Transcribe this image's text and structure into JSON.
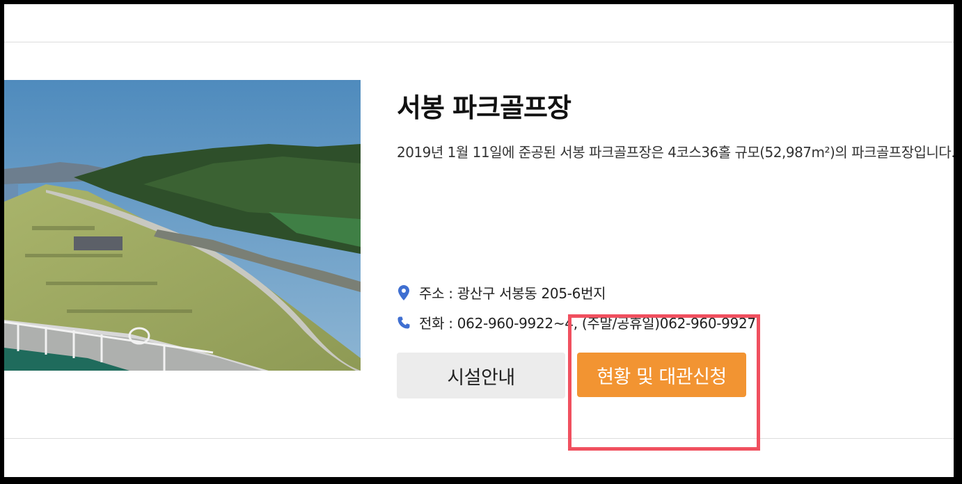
{
  "facility": {
    "title": "서봉 파크골프장",
    "description": "2019년 1월 11일에 준공된 서봉 파크골프장은 4코스36홀 규모(52,987m²)의 파크골프장입니다.",
    "address_label": "주소 : 광산구 서봉동 205-6번지",
    "phone_label": "전화 : 062-960-9922~4, (주말/공휴일)062-960-9927"
  },
  "buttons": {
    "facility_info": "시설안내",
    "status_reservation": "현황 및 대관신청"
  },
  "colors": {
    "accent": "#f29432",
    "highlight": "#f0505f",
    "icon": "#3f6fd1"
  },
  "icons": {
    "address": "location-pin-icon",
    "phone": "phone-icon"
  }
}
